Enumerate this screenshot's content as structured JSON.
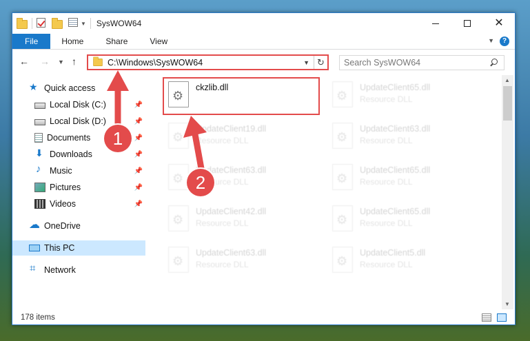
{
  "window": {
    "title": "SysWOW64"
  },
  "ribbon": {
    "tabs": [
      {
        "label": "File"
      },
      {
        "label": "Home"
      },
      {
        "label": "Share"
      },
      {
        "label": "View"
      }
    ],
    "help": "?"
  },
  "address": {
    "path": "C:\\Windows\\SysWOW64",
    "search_placeholder": "Search SysWOW64"
  },
  "nav_pane": {
    "quick_access": "Quick access",
    "items": [
      {
        "label": "Local Disk (C:)",
        "icon": "drive-icon"
      },
      {
        "label": "Local Disk (D:)",
        "icon": "drive-icon"
      },
      {
        "label": "Documents",
        "icon": "documents-icon"
      },
      {
        "label": "Downloads",
        "icon": "downloads-icon"
      },
      {
        "label": "Music",
        "icon": "music-icon"
      },
      {
        "label": "Pictures",
        "icon": "pictures-icon"
      },
      {
        "label": "Videos",
        "icon": "videos-icon"
      }
    ],
    "onedrive": "OneDrive",
    "this_pc": "This PC",
    "network": "Network"
  },
  "files": [
    {
      "name": "ckzlib.dll",
      "type": ""
    },
    {
      "name": "UpdateClient65.dll",
      "type": "Resource DLL"
    },
    {
      "name": "UpdateClient19.dll",
      "type": "Resource DLL"
    },
    {
      "name": "UpdateClient63.dll",
      "type": "Resource DLL"
    },
    {
      "name": "UpdateClient63.dll",
      "type": "Resource DLL"
    },
    {
      "name": "UpdateClient65.dll",
      "type": "Resource DLL"
    },
    {
      "name": "UpdateClient42.dll",
      "type": "Resource DLL"
    },
    {
      "name": "UpdateClient65.dll",
      "type": "Resource DLL"
    },
    {
      "name": "UpdateClient63.dll",
      "type": "Resource DLL"
    },
    {
      "name": "UpdateClient5.dll",
      "type": "Resource DLL"
    }
  ],
  "status": {
    "item_count": "178 items"
  },
  "callouts": {
    "step1": "1",
    "step2": "2",
    "color": "#e34b4b"
  }
}
